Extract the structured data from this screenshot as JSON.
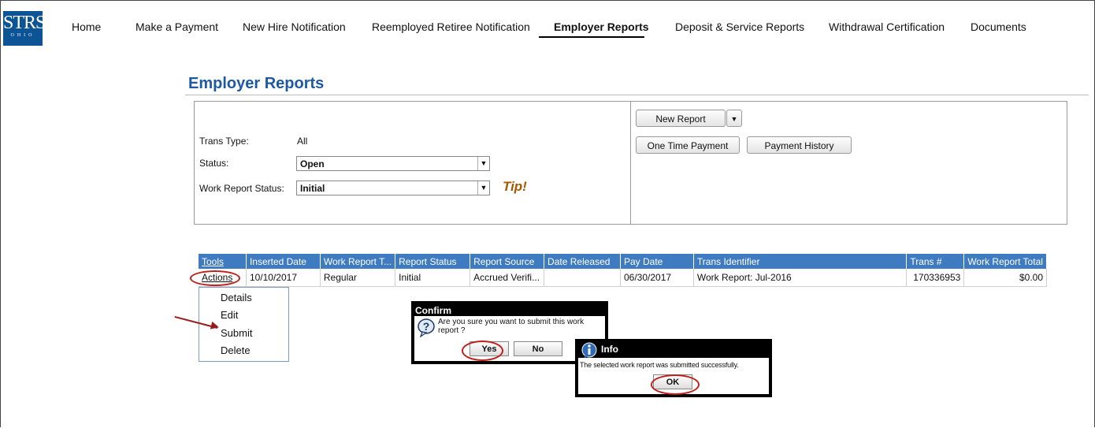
{
  "logo": {
    "text": "STRS",
    "subtext": "OHIO"
  },
  "nav": {
    "items": [
      "Home",
      "Make a Payment",
      "New Hire Notification",
      "Reemployed Retiree Notification",
      "Employer Reports",
      "Deposit & Service Reports",
      "Withdrawal Certification",
      "Documents"
    ],
    "active_index": 4
  },
  "page": {
    "title": "Employer Reports",
    "tip": "Tip!"
  },
  "filters": {
    "trans_type": {
      "label": "Trans Type:",
      "value": "All"
    },
    "status": {
      "label": "Status:",
      "value": "Open"
    },
    "work_report_status": {
      "label": "Work Report Status:",
      "value": "Initial"
    }
  },
  "actions": {
    "new_report": "New Report",
    "one_time_payment": "One Time Payment",
    "payment_history": "Payment History"
  },
  "table": {
    "headers": [
      "Tools",
      "Inserted Date",
      "Work Report T...",
      "Report Status",
      "Report Source",
      "Date Released",
      "Pay Date",
      "Trans Identifier",
      "Trans #",
      "Work Report Total"
    ],
    "rows": [
      [
        "Actions",
        "10/10/2017",
        "Regular",
        "Initial",
        "Accrued Verifi...",
        "",
        "06/30/2017",
        "Work Report: Jul-2016",
        "170336953",
        "$0.00"
      ]
    ]
  },
  "context_menu": {
    "items": [
      "Details",
      "Edit",
      "Submit",
      "Delete"
    ]
  },
  "confirm_dialog": {
    "title": "Confirm",
    "message": "Are you sure you want to submit this work report ?",
    "yes": "Yes",
    "no": "No"
  },
  "info_dialog": {
    "title": "Info",
    "message": "The selected work report was submitted successfully.",
    "ok": "OK"
  },
  "colors": {
    "brand_blue": "#0d5496",
    "title_blue": "#1d5aa3",
    "header_blue": "#3f7bc0",
    "highlight_red": "#c0201c",
    "tip_orange": "#a55a00"
  }
}
